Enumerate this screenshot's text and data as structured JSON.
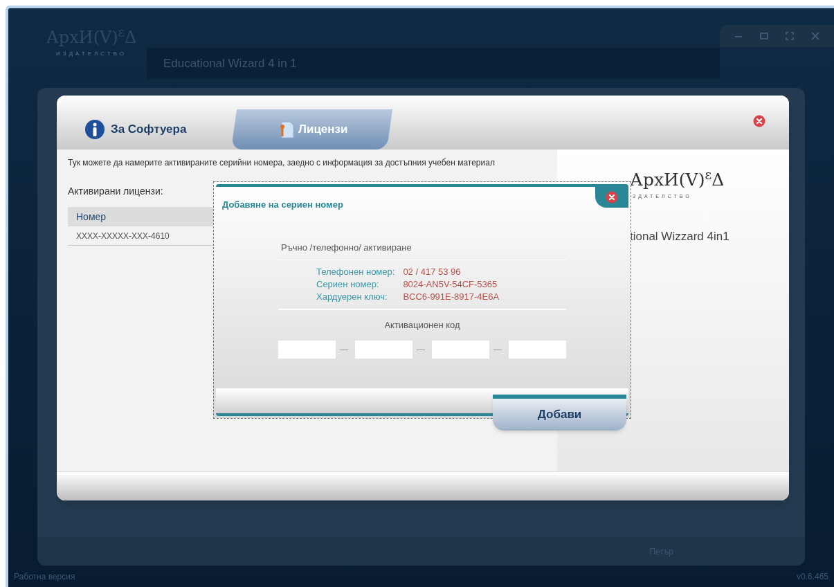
{
  "app": {
    "logo": "АрхИ(V)$^{ε}$Δ",
    "logo_subtitle": "ИЗДАТЕЛСТВО",
    "title": "Educational Wizard 4 in 1"
  },
  "background_window": {
    "user": "Петър"
  },
  "status_bar": {
    "left": "Работна версия",
    "version": "v0.6.465"
  },
  "dialog": {
    "tabs": [
      {
        "label": "За Софтуера",
        "selected": false,
        "kind": "info"
      },
      {
        "label": "Лицензи",
        "selected": true,
        "kind": "license"
      }
    ],
    "intro": "Тук можете да намерите активираните серийни номера, заедно с информация за достъпния учебен материал",
    "licenses_label": "Активирани лицензи:",
    "table": {
      "columns": [
        "Номер"
      ],
      "rows": [
        [
          "XXXX-XXXXX-XXX-4610"
        ]
      ]
    },
    "side": {
      "logo": "АрхИ(V)$^{ε}$Δ",
      "logo_subtitle": "ЗДАТЕЛСТВО",
      "product": "tional Wizzard 4in1"
    }
  },
  "modal": {
    "title": "Добавяне на сериен номер",
    "section": "Ръчно /телефонно/ активиране",
    "details": [
      {
        "label": "Телефонен номер:",
        "value": "02 / 417 53 96"
      },
      {
        "label": "Сериен номер:",
        "value": "8024-AN5V-54CF-5365"
      },
      {
        "label": "Хардуерен ключ:",
        "value": "BCC6-991E-8917-4E6A"
      }
    ],
    "code_label": "Активационен код",
    "separators": [
      "—",
      "—",
      "—"
    ],
    "button": "Добави"
  }
}
